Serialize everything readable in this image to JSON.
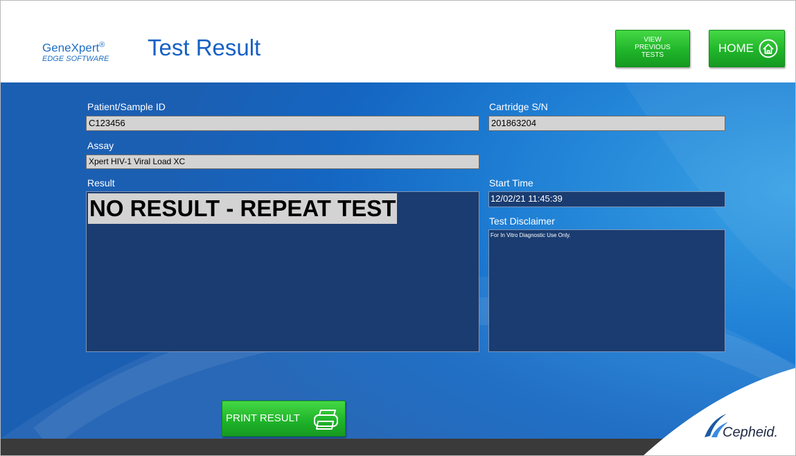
{
  "brand": {
    "line1": "GeneXpert",
    "reg": "®",
    "line2": "EDGE SOFTWARE"
  },
  "page_title": "Test Result",
  "buttons": {
    "view_previous": "VIEW\nPREVIOUS\nTESTS",
    "home": "HOME",
    "print": "PRINT RESULT"
  },
  "fields": {
    "patient_label": "Patient/Sample ID",
    "patient_value": "C123456",
    "cartridge_label": "Cartridge S/N",
    "cartridge_value": "201863204",
    "assay_label": "Assay",
    "assay_value": "Xpert HIV-1 Viral Load XC",
    "result_label": "Result",
    "result_value": "NO RESULT - REPEAT TEST",
    "start_label": "Start Time",
    "start_value": "12/02/21 11:45:39",
    "disclaimer_label": "Test Disclaimer",
    "disclaimer_value": "For In Vitro Diagnostic Use Only."
  },
  "logo": {
    "text": "Cepheid."
  },
  "colors": {
    "accent_green": "#20b52a",
    "header_blue": "#1560c4",
    "panel_dark": "#1a3c70"
  },
  "icons": {
    "home": "home-icon",
    "print": "printer-icon"
  }
}
